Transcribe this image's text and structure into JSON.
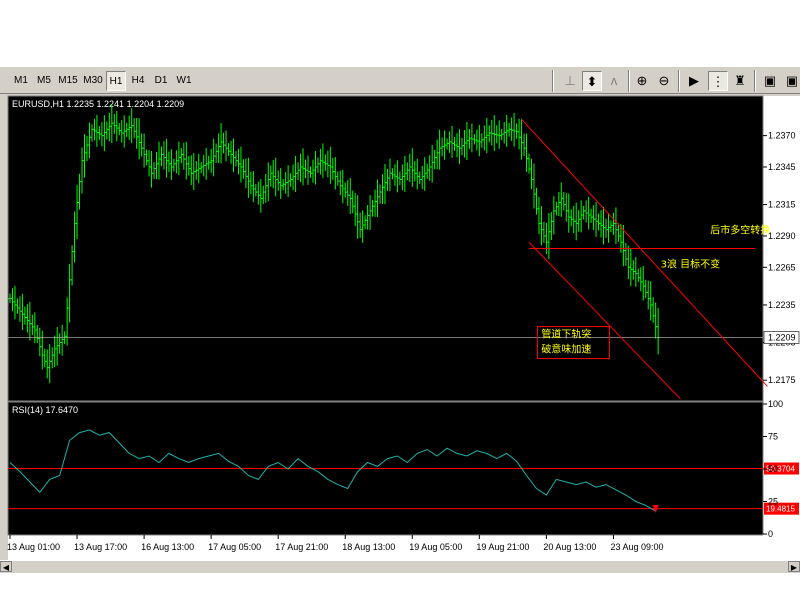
{
  "toolbar": {
    "timeframes": [
      "M1",
      "M5",
      "M15",
      "M30",
      "H1",
      "H4",
      "D1",
      "W1"
    ],
    "active_timeframe": "H1"
  },
  "chart_data": [
    {
      "type": "candlestick",
      "symbol_header": "EURUSD,H1  1.2235 1.2241 1.2204 1.2209",
      "ylim": [
        1.216,
        1.24
      ],
      "y_ticks": [
        "1.2370",
        "1.2345",
        "1.2315",
        "1.2290",
        "1.2265",
        "1.2235",
        "1.2205",
        "1.2175"
      ],
      "y_tick_values": [
        1.237,
        1.2345,
        1.2315,
        1.229,
        1.2265,
        1.2235,
        1.2205,
        1.2175
      ],
      "current_price_label": "1.2209",
      "current_price": 1.2209,
      "close_path": [
        [
          0,
          1.224
        ],
        [
          6,
          1.2225
        ],
        [
          10,
          1.2215
        ],
        [
          13,
          1.2195
        ],
        [
          15,
          1.2185
        ],
        [
          18,
          1.22
        ],
        [
          22,
          1.221
        ],
        [
          26,
          1.23
        ],
        [
          29,
          1.235
        ],
        [
          33,
          1.2375
        ],
        [
          37,
          1.237
        ],
        [
          41,
          1.238
        ],
        [
          45,
          1.2372
        ],
        [
          49,
          1.2378
        ],
        [
          53,
          1.236
        ],
        [
          57,
          1.234
        ],
        [
          61,
          1.2355
        ],
        [
          65,
          1.2345
        ],
        [
          69,
          1.2355
        ],
        [
          73,
          1.234
        ],
        [
          77,
          1.2345
        ],
        [
          81,
          1.235
        ],
        [
          85,
          1.2365
        ],
        [
          89,
          1.2355
        ],
        [
          93,
          1.2345
        ],
        [
          97,
          1.233
        ],
        [
          101,
          1.232
        ],
        [
          105,
          1.234
        ],
        [
          109,
          1.233
        ],
        [
          113,
          1.2335
        ],
        [
          117,
          1.2345
        ],
        [
          121,
          1.234
        ],
        [
          125,
          1.235
        ],
        [
          129,
          1.2345
        ],
        [
          133,
          1.233
        ],
        [
          137,
          1.232
        ],
        [
          141,
          1.2295
        ],
        [
          145,
          1.231
        ],
        [
          149,
          1.2325
        ],
        [
          153,
          1.234
        ],
        [
          157,
          1.2335
        ],
        [
          161,
          1.2345
        ],
        [
          165,
          1.2335
        ],
        [
          169,
          1.2345
        ],
        [
          173,
          1.236
        ],
        [
          177,
          1.2365
        ],
        [
          181,
          1.236
        ],
        [
          185,
          1.2368
        ],
        [
          189,
          1.2365
        ],
        [
          193,
          1.2372
        ],
        [
          197,
          1.237
        ],
        [
          201,
          1.2375
        ],
        [
          204,
          1.2373
        ],
        [
          207,
          1.236
        ],
        [
          210,
          1.2335
        ],
        [
          213,
          1.23
        ],
        [
          216,
          1.2285
        ],
        [
          219,
          1.231
        ],
        [
          222,
          1.232
        ],
        [
          225,
          1.2305
        ],
        [
          228,
          1.23
        ],
        [
          231,
          1.231
        ],
        [
          234,
          1.2305
        ],
        [
          237,
          1.23
        ],
        [
          240,
          1.2295
        ],
        [
          243,
          1.23
        ],
        [
          246,
          1.2285
        ],
        [
          249,
          1.2265
        ],
        [
          252,
          1.226
        ],
        [
          255,
          1.225
        ],
        [
          258,
          1.2235
        ],
        [
          261,
          1.2209
        ]
      ],
      "trend_lines": [
        {
          "from": [
            206,
            1.2383
          ],
          "to": [
            305,
            1.217
          ]
        },
        {
          "from": [
            209,
            1.2285
          ],
          "to": [
            270,
            1.216
          ]
        }
      ],
      "horizontal_levels": [
        1.228
      ],
      "annotations": [
        {
          "text": "后市多空转换",
          "x": 282,
          "y": 1.2292
        },
        {
          "text": "3浪 目标不变",
          "x": 262,
          "y": 1.2265
        },
        {
          "text": "管道下轨突",
          "x": 214,
          "y": 1.2209
        },
        {
          "text": "破意味加速",
          "x": 214,
          "y": 1.2197
        }
      ],
      "x_tick_labels": [
        "13 Aug 01:00",
        "13 Aug 17:00",
        "16 Aug 13:00",
        "17 Aug 05:00",
        "17 Aug 21:00",
        "18 Aug 13:00",
        "19 Aug 05:00",
        "19 Aug 21:00",
        "20 Aug 13:00",
        "23 Aug 09:00"
      ],
      "x_tick_positions": [
        0,
        27,
        54,
        81,
        108,
        135,
        162,
        189,
        216,
        243
      ]
    },
    {
      "type": "line",
      "indicator_header": "RSI(14)  17.6470",
      "ylim": [
        0,
        100
      ],
      "y_ticks": [
        "100",
        "75",
        "50",
        "25",
        "0"
      ],
      "y_tick_values": [
        100,
        75,
        50,
        25,
        0
      ],
      "level_labels": [
        "50.3704",
        "19.4815"
      ],
      "levels": [
        50.3704,
        19.4815
      ],
      "rsi_path": [
        [
          0,
          55
        ],
        [
          4,
          48
        ],
        [
          8,
          40
        ],
        [
          12,
          32
        ],
        [
          16,
          42
        ],
        [
          20,
          45
        ],
        [
          24,
          72
        ],
        [
          28,
          78
        ],
        [
          32,
          80
        ],
        [
          36,
          76
        ],
        [
          40,
          78
        ],
        [
          44,
          70
        ],
        [
          48,
          62
        ],
        [
          52,
          58
        ],
        [
          56,
          60
        ],
        [
          60,
          55
        ],
        [
          64,
          62
        ],
        [
          68,
          58
        ],
        [
          72,
          55
        ],
        [
          76,
          58
        ],
        [
          80,
          60
        ],
        [
          84,
          62
        ],
        [
          88,
          56
        ],
        [
          92,
          52
        ],
        [
          96,
          45
        ],
        [
          100,
          42
        ],
        [
          104,
          52
        ],
        [
          108,
          55
        ],
        [
          112,
          50
        ],
        [
          116,
          58
        ],
        [
          120,
          52
        ],
        [
          124,
          48
        ],
        [
          128,
          42
        ],
        [
          132,
          38
        ],
        [
          136,
          35
        ],
        [
          140,
          48
        ],
        [
          144,
          55
        ],
        [
          148,
          52
        ],
        [
          152,
          58
        ],
        [
          156,
          60
        ],
        [
          160,
          55
        ],
        [
          164,
          62
        ],
        [
          168,
          65
        ],
        [
          172,
          60
        ],
        [
          176,
          66
        ],
        [
          180,
          62
        ],
        [
          184,
          60
        ],
        [
          188,
          64
        ],
        [
          192,
          62
        ],
        [
          196,
          58
        ],
        [
          200,
          62
        ],
        [
          204,
          56
        ],
        [
          208,
          45
        ],
        [
          212,
          35
        ],
        [
          216,
          30
        ],
        [
          220,
          42
        ],
        [
          224,
          40
        ],
        [
          228,
          38
        ],
        [
          232,
          40
        ],
        [
          236,
          36
        ],
        [
          240,
          38
        ],
        [
          244,
          34
        ],
        [
          248,
          30
        ],
        [
          252,
          25
        ],
        [
          256,
          22
        ],
        [
          260,
          17.647
        ]
      ]
    }
  ]
}
